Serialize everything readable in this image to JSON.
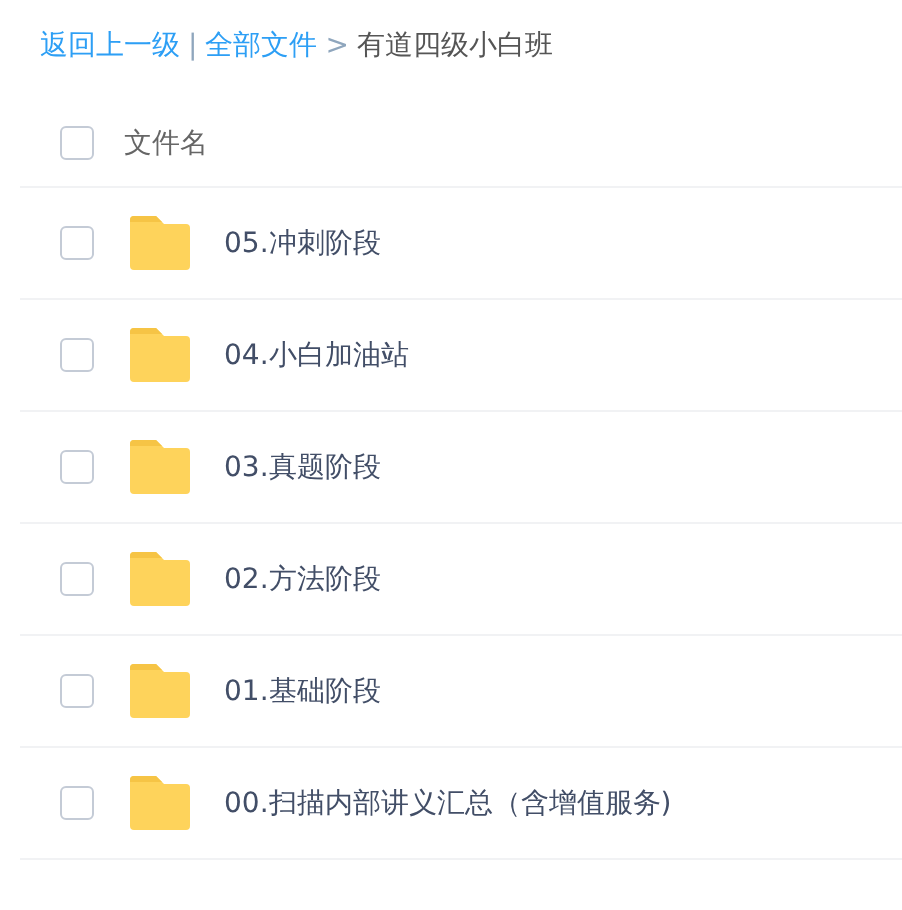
{
  "breadcrumb": {
    "back": "返回上一级",
    "separator": "|",
    "root": "全部文件",
    "arrow": ">",
    "current": "有道四级小白班"
  },
  "table": {
    "header": {
      "label": "文件名",
      "checked": false
    },
    "rows": [
      {
        "name": "05.冲刺阶段",
        "checked": false
      },
      {
        "name": "04.小白加油站",
        "checked": false
      },
      {
        "name": "03.真题阶段",
        "checked": false
      },
      {
        "name": "02.方法阶段",
        "checked": false
      },
      {
        "name": "01.基础阶段",
        "checked": false
      },
      {
        "name": "00.扫描内部讲义汇总（含增值服务)",
        "checked": false
      }
    ]
  }
}
